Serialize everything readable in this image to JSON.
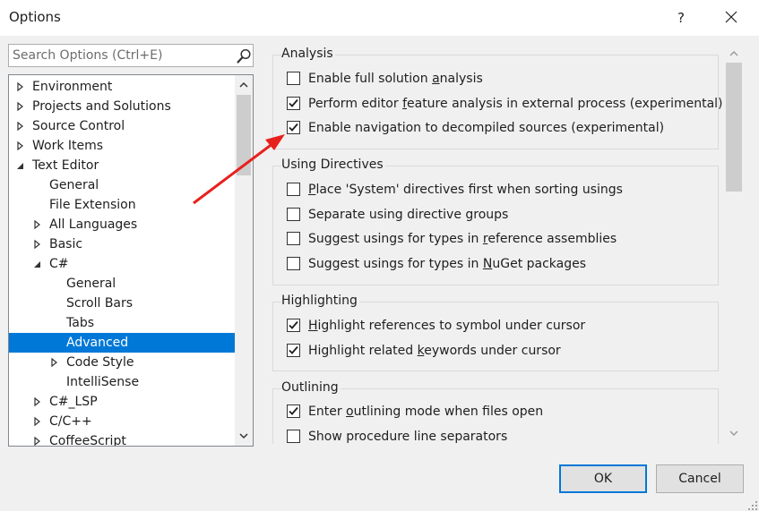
{
  "window": {
    "title": "Options",
    "help_label": "?",
    "close_icon": "close-icon"
  },
  "search": {
    "placeholder": "Search Options (Ctrl+E)",
    "icon": "search-icon"
  },
  "tree": {
    "items": [
      {
        "label": "Environment",
        "expanded": false,
        "has_children": true
      },
      {
        "label": "Projects and Solutions",
        "expanded": false,
        "has_children": true
      },
      {
        "label": "Source Control",
        "expanded": false,
        "has_children": true
      },
      {
        "label": "Work Items",
        "expanded": false,
        "has_children": true
      },
      {
        "label": "Text Editor",
        "expanded": true,
        "has_children": true
      },
      {
        "label": "General",
        "has_children": false
      },
      {
        "label": "File Extension",
        "has_children": false
      },
      {
        "label": "All Languages",
        "expanded": false,
        "has_children": true
      },
      {
        "label": "Basic",
        "expanded": false,
        "has_children": true
      },
      {
        "label": "C#",
        "expanded": true,
        "has_children": true
      },
      {
        "label": "General",
        "has_children": false
      },
      {
        "label": "Scroll Bars",
        "has_children": false
      },
      {
        "label": "Tabs",
        "has_children": false
      },
      {
        "label": "Advanced",
        "has_children": false,
        "selected": true
      },
      {
        "label": "Code Style",
        "expanded": false,
        "has_children": true
      },
      {
        "label": "IntelliSense",
        "has_children": false
      },
      {
        "label": "C#_LSP",
        "expanded": false,
        "has_children": true
      },
      {
        "label": "C/C++",
        "expanded": false,
        "has_children": true
      },
      {
        "label": "CoffeeScript",
        "expanded": false,
        "has_children": true
      }
    ]
  },
  "groups": {
    "analysis": {
      "title": "Analysis",
      "options": [
        {
          "pre": "Enable full solution ",
          "u": "a",
          "post": "nalysis",
          "checked": false
        },
        {
          "pre": "Perform editor ",
          "u": "f",
          "post": "eature analysis in external process (experimental)",
          "checked": true
        },
        {
          "pre": "Enable navigation to decompiled sources (experimental)",
          "u": "",
          "post": "",
          "checked": true
        }
      ]
    },
    "using": {
      "title": "Using Directives",
      "options": [
        {
          "pre": "",
          "u": "P",
          "post": "lace 'System' directives first when sorting usings",
          "checked": false
        },
        {
          "pre": "Separate using directive groups",
          "u": "",
          "post": "",
          "checked": false
        },
        {
          "pre": "Suggest usings for types in ",
          "u": "r",
          "post": "eference assemblies",
          "checked": false
        },
        {
          "pre": "Suggest usings for types in ",
          "u": "N",
          "post": "uGet packages",
          "checked": false
        }
      ]
    },
    "highlighting": {
      "title": "Highlighting",
      "options": [
        {
          "pre": "",
          "u": "H",
          "post": "ighlight references to symbol under cursor",
          "checked": true
        },
        {
          "pre": "Highlight related ",
          "u": "k",
          "post": "eywords under cursor",
          "checked": true
        }
      ]
    },
    "outlining": {
      "title": "Outlining",
      "options": [
        {
          "pre": "Enter ",
          "u": "o",
          "post": "utlining mode when files open",
          "checked": true
        },
        {
          "pre": "Show procedure line separators",
          "u": "",
          "post": "",
          "checked": false
        }
      ]
    }
  },
  "buttons": {
    "ok": "OK",
    "cancel": "Cancel"
  },
  "colors": {
    "selection": "#0078d7",
    "annotation_arrow": "#e8201c"
  }
}
